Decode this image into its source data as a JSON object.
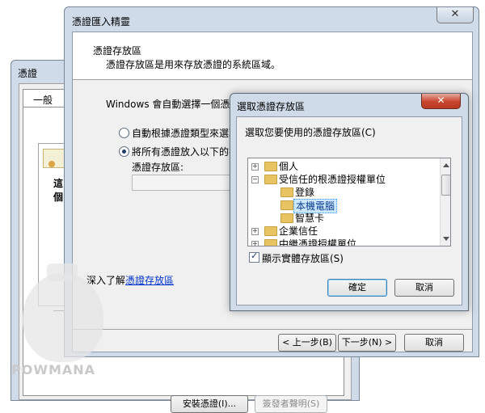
{
  "certificate_window": {
    "title": "憑證",
    "tab": "一般",
    "issued_to_prefix": "這個",
    "buttons": {
      "install": "安裝憑證(I)...",
      "issuer_statement": "簽發者聲明(S)"
    }
  },
  "wizard": {
    "title": "憑證匯入精靈",
    "close_glyph": "✕",
    "header_title": "憑證存放區",
    "header_desc": "憑證存放區是用來存放憑證的系統區域。",
    "instruction": "Windows 會自動選擇一個憑證",
    "radio_auto": "自動根據憑證類型來選取",
    "radio_manual": "將所有憑證放入以下的存",
    "store_label": "憑證存放區:",
    "learn_more_prefix": "深入了解",
    "learn_more_link": "憑證存放區",
    "buttons": {
      "back": "< 上一步(B)",
      "next": "下一步(N) >",
      "cancel": "取消"
    }
  },
  "select_store_dialog": {
    "title": "選取憑證存放區",
    "close_glyph": "✕",
    "prompt": "選取您要使用的憑證存放區(C)",
    "tree": [
      {
        "label": "個人",
        "expander": "+",
        "indent": 0
      },
      {
        "label": "受信任的根憑證授權單位",
        "expander": "−",
        "indent": 0
      },
      {
        "label": "登錄",
        "expander": "",
        "indent": 1
      },
      {
        "label": "本機電腦",
        "expander": "",
        "indent": 1,
        "selected": true
      },
      {
        "label": "智慧卡",
        "expander": "",
        "indent": 1
      },
      {
        "label": "企業信任",
        "expander": "+",
        "indent": 0
      },
      {
        "label": "中繼憑證授權單位",
        "expander": "+",
        "indent": 0
      }
    ],
    "show_physical_stores": "顯示實體存放區(S)",
    "buttons": {
      "ok": "確定",
      "cancel": "取消"
    }
  },
  "watermark": {
    "text": "POWMANA"
  }
}
